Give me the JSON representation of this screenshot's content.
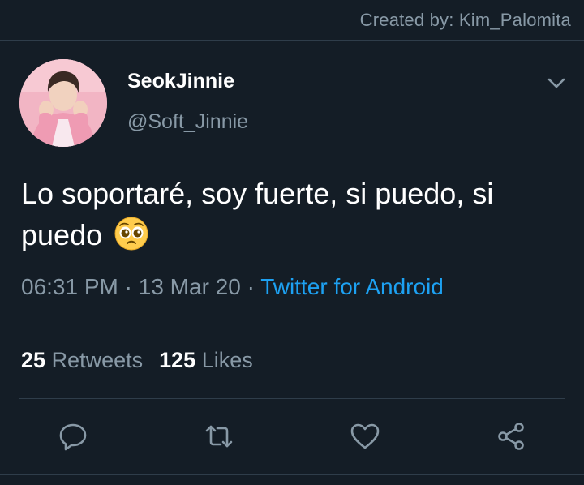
{
  "credit": "Created by: Kim_Palomita",
  "tweet": {
    "display_name": "SeokJinnie",
    "handle": "@Soft_Jinnie",
    "text": "Lo soportaré, soy fuerte, si puedo, si puedo",
    "emoji_icon": "pleading-face-emoji",
    "time": "06:31 PM",
    "separator": "·",
    "date": "13 Mar 20",
    "source": "Twitter for Android"
  },
  "stats": {
    "retweets_count": "25",
    "retweets_label": "Retweets",
    "likes_count": "125",
    "likes_label": "Likes"
  },
  "actions": {
    "reply_icon": "reply-icon",
    "retweet_icon": "retweet-icon",
    "like_icon": "heart-icon",
    "share_icon": "share-icon"
  },
  "colors": {
    "background": "#141d26",
    "muted_text": "#8899a6",
    "link": "#1da1f2",
    "divider": "#2f3d4a"
  }
}
